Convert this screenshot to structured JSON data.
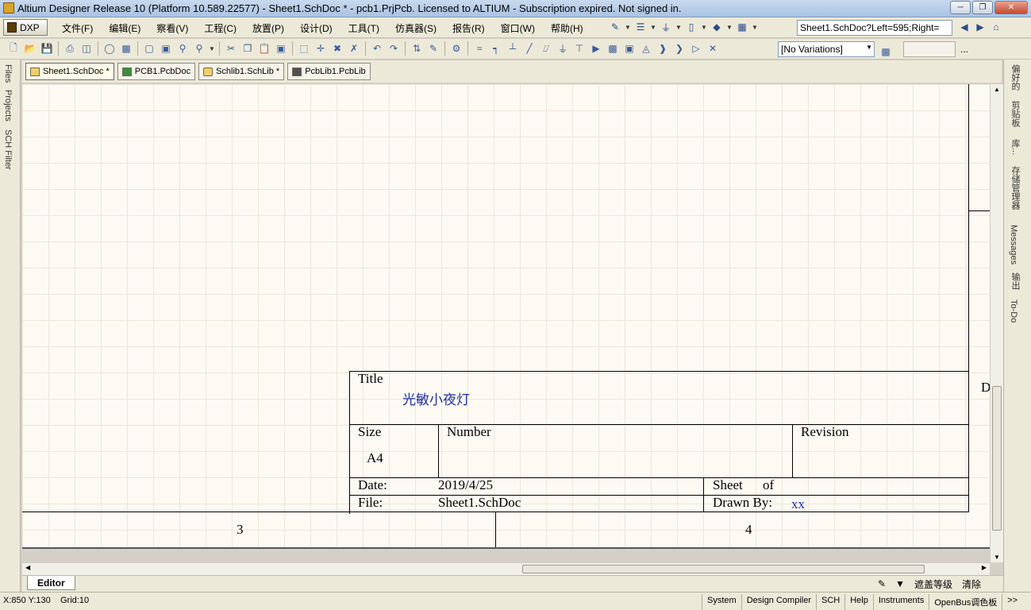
{
  "window": {
    "title": "Altium Designer Release 10 (Platform 10.589.22577) - Sheet1.SchDoc * - pcb1.PrjPcb. Licensed to ALTIUM - Subscription expired. Not signed in."
  },
  "menu": {
    "dxp_label": "DXP",
    "items": [
      "文件(F)",
      "编辑(E)",
      "察看(V)",
      "工程(C)",
      "放置(P)",
      "设计(D)",
      "工具(T)",
      "仿真器(S)",
      "报告(R)",
      "窗口(W)",
      "帮助(H)"
    ]
  },
  "toolbar": {
    "location": "Sheet1.SchDoc?Left=595;Right=",
    "variations": "[No Variations]",
    "overflow": "..."
  },
  "left_panel_tabs": [
    "Files",
    "Projects",
    "SCH Filter"
  ],
  "right_panel_tabs": [
    "偏好的",
    "剪贴板",
    "库...",
    "存储管理器",
    "Messages",
    "输出",
    "To-Do"
  ],
  "document_tabs": [
    {
      "label": "Sheet1.SchDoc *",
      "icon": "schematic-doc-icon"
    },
    {
      "label": "PCB1.PcbDoc",
      "icon": "pcb-doc-icon"
    },
    {
      "label": "Schlib1.SchLib *",
      "icon": "schlib-icon"
    },
    {
      "label": "PcbLib1.PcbLib",
      "icon": "pcblib-icon"
    }
  ],
  "title_block": {
    "title_label": "Title",
    "title_value": "光敏小夜灯",
    "size_label": "Size",
    "size_value": "A4",
    "number_label": "Number",
    "revision_label": "Revision",
    "date_label": "Date:",
    "date_value": "2019/4/25",
    "sheet_label": "Sheet",
    "of_label": "of",
    "file_label": "File:",
    "file_value": "Sheet1.SchDoc",
    "drawn_by_label": "Drawn By:",
    "drawn_by_value": "xx",
    "zone_d": "D"
  },
  "border_zones": {
    "col_3": "3",
    "col_4": "4"
  },
  "editor": {
    "tab_label": "Editor",
    "mask_level": "遮盖等级",
    "clear": "清除"
  },
  "status": {
    "coords": "X:850 Y:130",
    "grid": "Grid:10",
    "panels": [
      "System",
      "Design Compiler",
      "SCH",
      "Help",
      "Instruments",
      "OpenBus调色板"
    ],
    "overflow": ">>"
  },
  "colors": {
    "sheet_background": "#fcfaf3",
    "grid_line": "#ebe7d8",
    "title_value_text": "#1e2fa8"
  }
}
